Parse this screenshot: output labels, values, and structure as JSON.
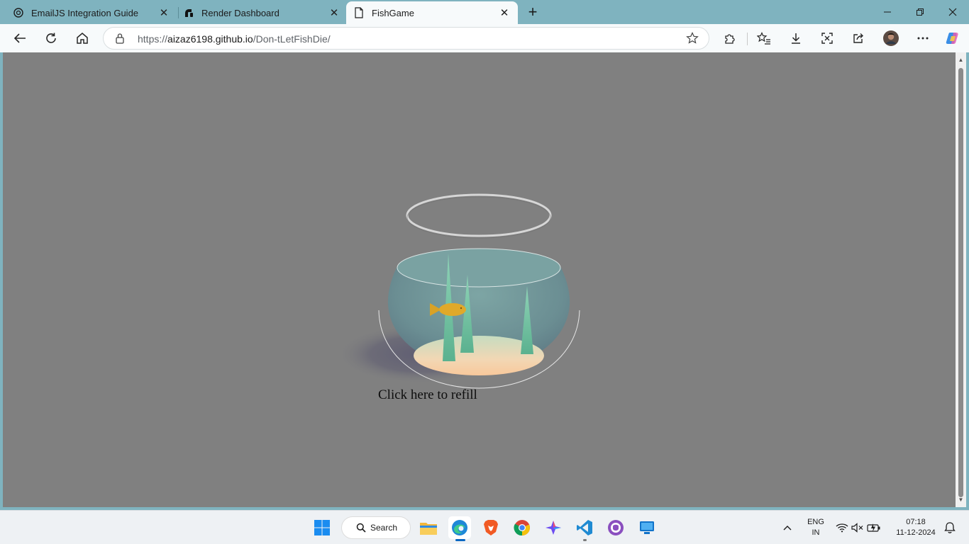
{
  "browser": {
    "tabs": [
      {
        "title": "EmailJS Integration Guide",
        "icon": "openai-icon",
        "active": false
      },
      {
        "title": "Render Dashboard",
        "icon": "render-icon",
        "active": false
      },
      {
        "title": "FishGame",
        "icon": "page-icon",
        "active": true
      }
    ],
    "new_tab_label": "+",
    "address": {
      "url_prefix": "https://",
      "url_host": "aizaz6198.github.io",
      "url_path": "/Don-tLetFishDie/"
    }
  },
  "page": {
    "background_color": "#808080",
    "refill_text": "Click here to refill",
    "plants_color": "#6bbf9e",
    "fish_color": "#e0a92a",
    "sand_color": "#f5d2a8"
  },
  "taskbar": {
    "search_label": "Search",
    "language_line1": "ENG",
    "language_line2": "IN",
    "time": "07:18",
    "date": "11-12-2024"
  }
}
